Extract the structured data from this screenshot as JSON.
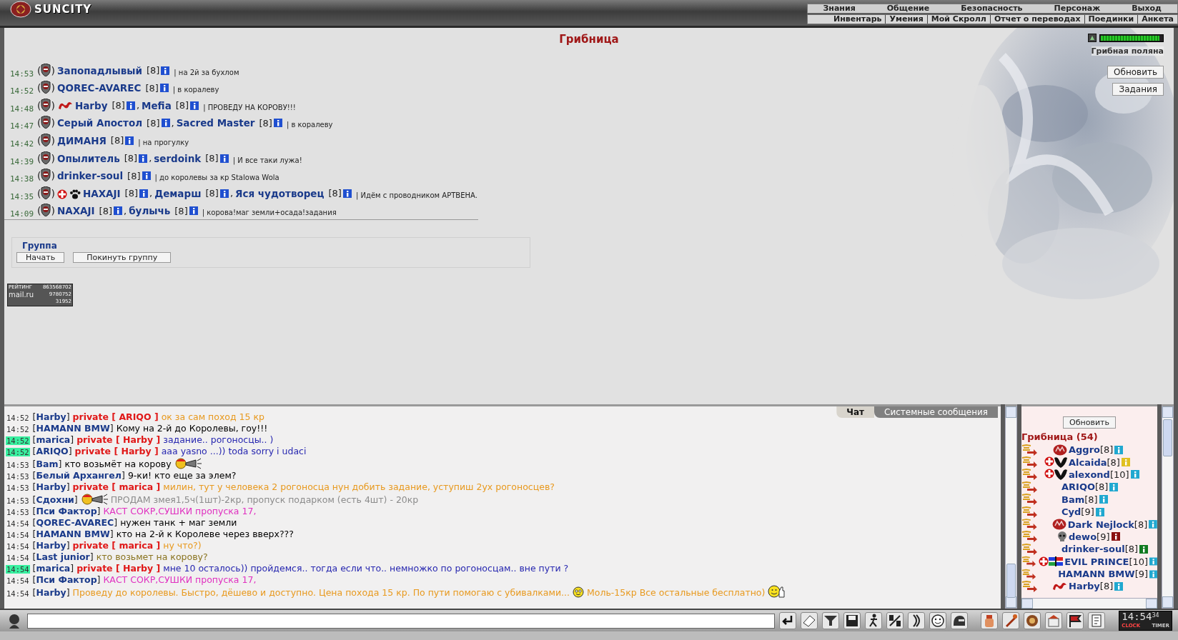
{
  "top_bar": {
    "logo": "SUNCITY",
    "nav_main": [
      "Знания",
      "Общение",
      "Безопасность",
      "Персонаж",
      "Выход"
    ],
    "nav_sub": [
      "Инвентарь",
      "Умения",
      "Мой Скролл",
      "Отчет о переводах",
      "Поединки",
      "Анкета"
    ]
  },
  "location": {
    "title": "Грибница",
    "place_link": "Грибная поляна",
    "level": 0.95,
    "buttons": [
      "Обновить",
      "Задания"
    ]
  },
  "groups": [
    {
      "time": "14:53",
      "open": "(",
      "close": ")",
      "members": [
        {
          "name": "Запопадлывый",
          "rank": "[8]"
        }
      ],
      "note": "| на 2й за бухлом"
    },
    {
      "time": "14:52",
      "open": "(",
      "close": ")",
      "members": [
        {
          "name": "QOREC-AVAREC",
          "rank": "[8]"
        }
      ],
      "note": "| в кoралеву"
    },
    {
      "time": "14:48",
      "open": "(",
      "close": ")",
      "badges": [
        {
          "kind": "dragon"
        }
      ],
      "members": [
        {
          "name": "Harby",
          "rank": "[8]",
          "sep": ","
        },
        {
          "name": "Mefia",
          "rank": "[8]"
        }
      ],
      "note": "| ПРОВЕДУ НА КОРОВУ!!!"
    },
    {
      "time": "14:47",
      "open": "(",
      "close": ")",
      "members": [
        {
          "name": "Серый Апостол",
          "rank": "[8]",
          "sep": ","
        },
        {
          "name": "Sacred Master",
          "rank": "[8]"
        }
      ],
      "note": "| в кoралеву"
    },
    {
      "time": "14:42",
      "open": "(",
      "close": ")",
      "members": [
        {
          "name": "ДИМАНЯ",
          "rank": "[8]"
        }
      ],
      "note": "| на прогулку"
    },
    {
      "time": "14:39",
      "open": "(",
      "close": ")",
      "members": [
        {
          "name": "Опылитель",
          "rank": "[8]",
          "sep": ","
        },
        {
          "name": "serdoink",
          "rank": "[8]"
        }
      ],
      "note": "| И все таки лужа!"
    },
    {
      "time": "14:38",
      "open": "(",
      "close": ")",
      "members": [
        {
          "name": "drinker-soul",
          "rank": "[8]"
        }
      ],
      "note": "| до королевы за кр Stalowa Wola"
    },
    {
      "time": "14:35",
      "open": "(",
      "close": ")",
      "badges": [
        {
          "kind": "cross"
        },
        {
          "kind": "paw"
        }
      ],
      "members": [
        {
          "name": "HAXAJI",
          "rank": "[8]",
          "sep": ","
        },
        {
          "name": "Демарш",
          "rank": "[8]",
          "sep": ","
        },
        {
          "name": "Яся чудотворец",
          "rank": "[8]"
        }
      ],
      "note": "| Идём с проводником АРТВЕНА."
    },
    {
      "time": "14:09",
      "open": "(",
      "close": ")",
      "members": [
        {
          "name": "NAXAJI",
          "rank": "[8]",
          "sep": ","
        },
        {
          "name": "булычь",
          "rank": "[8]"
        }
      ],
      "note": "| корова!маг земли+осада!задания"
    }
  ],
  "group_panel": {
    "legend": "Группа",
    "buttons": [
      "Начать",
      "Покинуть группу"
    ]
  },
  "counter": {
    "label": "РЕЙТИНГ",
    "lines": [
      "863568702",
      "9780752",
      "31952"
    ],
    "brand": "mail.ru"
  },
  "chat": {
    "tabs": [
      {
        "label": "Чат",
        "selected": true
      },
      {
        "label": "Системные сообщения",
        "selected": false
      }
    ],
    "messages": [
      {
        "time": "14:52",
        "highlight": false,
        "sender": "[**Harby**]",
        "private": "private [ ARIQO ]",
        "color": "#e89a20",
        "parts": [
          {
            "kind": "text",
            "text": "ок за сам поход 15 кр"
          }
        ]
      },
      {
        "time": "14:52",
        "highlight": false,
        "sender": "[**HAMANN BMW**]",
        "color": "#000000",
        "parts": [
          {
            "kind": "text",
            "text": "Кому на 2-й до Королевы, гоу!!!"
          }
        ]
      },
      {
        "time": "14:52",
        "highlight": true,
        "sender": "[**marica**]",
        "private": "private [ Harby ]",
        "color": "#2828b0",
        "parts": [
          {
            "kind": "text",
            "text": "задание.. рогоносцы.. )"
          }
        ]
      },
      {
        "time": "14:52",
        "highlight": true,
        "sender": "[**ARIQO**]",
        "private": "private [ Harby ]",
        "color": "#2828b0",
        "parts": [
          {
            "kind": "text",
            "text": "aaa yasno ...)) toda sorry i udaci"
          }
        ]
      },
      {
        "time": "14:53",
        "highlight": false,
        "sender": "[**Bam**]",
        "color": "#000000",
        "parts": [
          {
            "kind": "text",
            "text": "кто возьмёт на корову"
          },
          {
            "kind": "megaphone"
          }
        ]
      },
      {
        "time": "14:53",
        "highlight": false,
        "sender": "[**Белый Архангел**]",
        "color": "#000000",
        "parts": [
          {
            "kind": "text",
            "text": "9-ки! кто еще за элем?"
          }
        ]
      },
      {
        "time": "14:53",
        "highlight": false,
        "sender": "[**Harby**]",
        "private": "private [ marica ]",
        "color": "#e89a20",
        "parts": [
          {
            "kind": "text",
            "text": "милин, тут у человека 2 рогоносца нун добить задание, уступиш 2ух рогоносцев?"
          }
        ]
      },
      {
        "time": "14:53",
        "highlight": false,
        "sender": "[**Сдохни**]",
        "color": "#8c8c8c",
        "parts": [
          {
            "kind": "megaphone"
          },
          {
            "kind": "text",
            "text": "ПРОДАМ змея1,5ч(1шт)-2кр, пропуск подарком (есть 4шт) - 20кр"
          }
        ]
      },
      {
        "time": "14:53",
        "highlight": false,
        "sender": "[**Пси Фактор**]",
        "color": "#e030c0",
        "parts": [
          {
            "kind": "text",
            "text": "КАСТ СОКР,СУШКИ пропуска 17,"
          }
        ]
      },
      {
        "time": "14:54",
        "highlight": false,
        "sender": "[**QOREC-AVAREC**]",
        "color": "#000000",
        "parts": [
          {
            "kind": "text",
            "text": "нужен танк + маг земли"
          }
        ]
      },
      {
        "time": "14:54",
        "highlight": false,
        "sender": "[**HAMANN BMW**]",
        "color": "#000000",
        "parts": [
          {
            "kind": "text",
            "text": "кто на 2-й к Королеве через вверх???"
          }
        ]
      },
      {
        "time": "14:54",
        "highlight": false,
        "sender": "[**Harby**]",
        "private": "private [ marica ]",
        "color": "#e89a20",
        "parts": [
          {
            "kind": "text",
            "text": "ну что?)"
          }
        ]
      },
      {
        "time": "14:54",
        "highlight": false,
        "sender": "[**Last junior**]",
        "color": "#8a7420",
        "parts": [
          {
            "kind": "text",
            "text": "кто возьмет на корову?"
          }
        ]
      },
      {
        "time": "14:54",
        "highlight": true,
        "sender": "[**marica**]",
        "private": "private [ Harby ]",
        "color": "#2828b0",
        "parts": [
          {
            "kind": "text",
            "text": "мне 10 осталось)) пройдемся.. тогда если что.. немножко по рогоносцам.. вне пути ?"
          }
        ]
      },
      {
        "time": "14:54",
        "highlight": false,
        "sender": "[**Пси Фактор**]",
        "color": "#e030c0",
        "parts": [
          {
            "kind": "text",
            "text": "КАСТ СОКР,СУШКИ пропуска 17,"
          }
        ]
      },
      {
        "time": "14:54",
        "highlight": false,
        "sender": "[**Harby**]",
        "color": "#e89a20",
        "parts": [
          {
            "kind": "text",
            "text": "Проведу до королевы. Быстро, дёшево и доступно. Цена похода 15 кр. По пути помогаю с убивалками..."
          },
          {
            "kind": "smiley"
          },
          {
            "kind": "text",
            "text": "Моль-15кр Все остальные бесплатно)"
          },
          {
            "kind": "thumbs"
          }
        ]
      }
    ]
  },
  "online": {
    "button": "Обновить",
    "title": "Грибница (54)",
    "users": [
      {
        "name": "Aggro",
        "rank": "[8]",
        "color": "#20a8d0",
        "badges": [
          {
            "kind": "clan"
          }
        ]
      },
      {
        "name": "Alcaida",
        "rank": "[8]",
        "color": "#e0c020",
        "badges": [
          {
            "kind": "cross"
          },
          {
            "kind": "wu"
          }
        ]
      },
      {
        "name": "alexond",
        "rank": "[10]",
        "color": "#20a8d0",
        "badges": [
          {
            "kind": "cross"
          },
          {
            "kind": "wu"
          }
        ]
      },
      {
        "name": "ARIQO",
        "rank": "[8]",
        "color": "#20a8d0"
      },
      {
        "name": "Bam",
        "rank": "[8]",
        "color": "#20a8d0"
      },
      {
        "name": "Cyd",
        "rank": "[9]",
        "color": "#20a8d0"
      },
      {
        "name": "Dark Nejlock",
        "rank": "[8]",
        "color": "#20a8d0",
        "badges": [
          {
            "kind": "clan"
          }
        ]
      },
      {
        "name": "dewo",
        "rank": "[9]",
        "color": "#8a1010",
        "badges": [
          {
            "kind": "skull"
          }
        ]
      },
      {
        "name": "drinker-soul",
        "rank": "[8]",
        "color": "#107a20"
      },
      {
        "name": "EVIL PRINCE",
        "rank": "[10]",
        "color": "#20a8d0",
        "badges": [
          {
            "kind": "cross"
          },
          {
            "kind": "flag"
          }
        ]
      },
      {
        "name": "HAMANN BMW",
        "rank": "[9]",
        "color": "#20a8d0"
      },
      {
        "name": "Harby",
        "rank": "[8]",
        "color": "#20a8d0",
        "badges": [
          {
            "kind": "dragon"
          }
        ]
      }
    ]
  },
  "bottom_bar": {
    "clock": "14:54",
    "seconds": "34",
    "clock_label": "CLOCK",
    "timer_label": "TIMER"
  }
}
